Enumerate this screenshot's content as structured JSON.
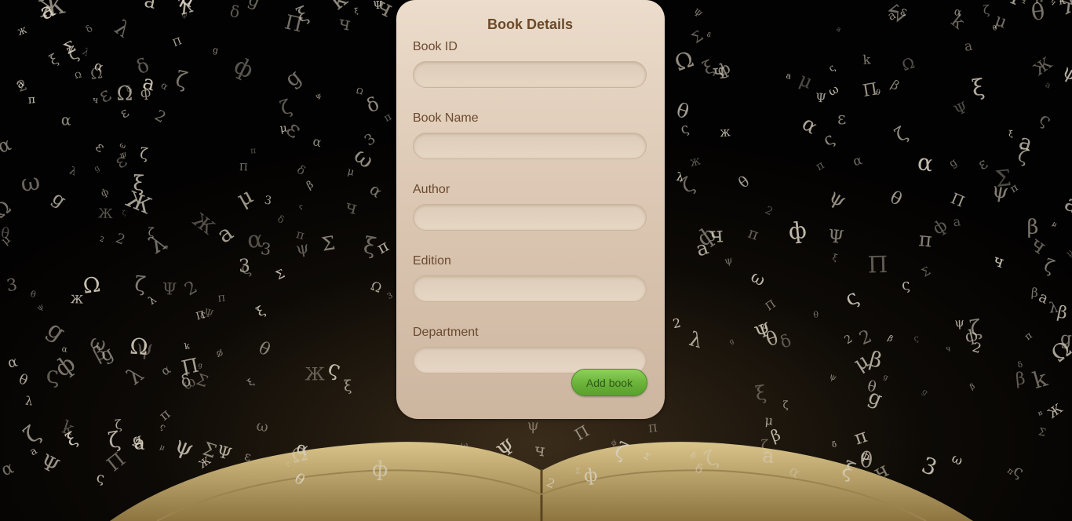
{
  "form": {
    "title": "Book Details",
    "fields": [
      {
        "label": "Book ID",
        "value": "",
        "placeholder": ""
      },
      {
        "label": "Book Name",
        "value": "",
        "placeholder": ""
      },
      {
        "label": "Author",
        "value": "",
        "placeholder": ""
      },
      {
        "label": "Edition",
        "value": "",
        "placeholder": ""
      },
      {
        "label": "Department",
        "value": "",
        "placeholder": ""
      }
    ],
    "submit_label": "Add book"
  },
  "colors": {
    "background": "#050403",
    "card_top": "#ecdccb",
    "card_bottom": "#cdb6a0",
    "title": "#6b4a2b",
    "button": "#6cb43c"
  },
  "background_image": {
    "description_icon": "open-book-with-flying-letters"
  }
}
